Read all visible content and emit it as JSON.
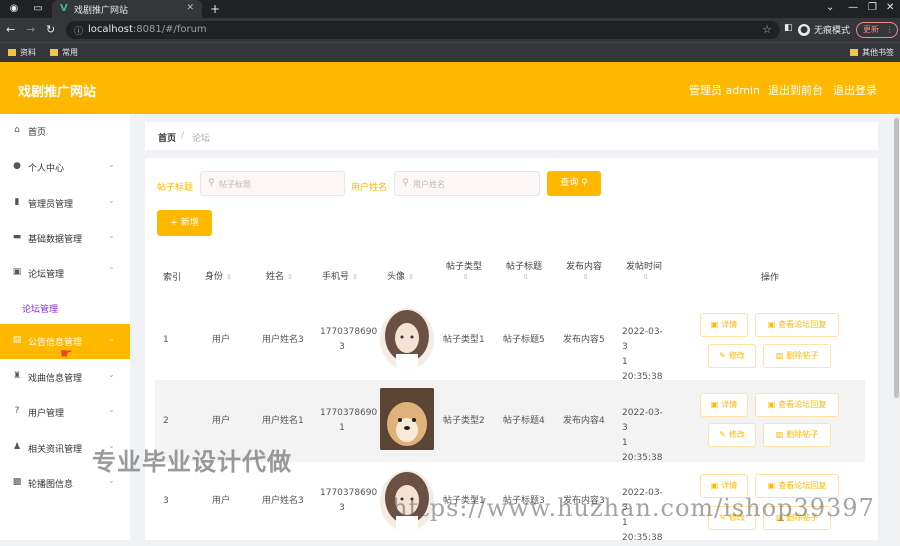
{
  "browser": {
    "tab_title": "戏剧推广网站",
    "url_host": "localhost",
    "url_rest": ":8081/#/forum",
    "profile_label": "无痕模式",
    "update_label": "更新",
    "bookmarks": [
      "资料",
      "常用"
    ],
    "other_bookmarks": "其他书签"
  },
  "header": {
    "title": "戏剧推广网站",
    "admin_label": "管理员 admin",
    "back_label": "退出到前台",
    "logout_label": "退出登录"
  },
  "sidebar": {
    "items": [
      {
        "label": "首页",
        "icon": "home-icon"
      },
      {
        "label": "个人中心",
        "icon": "user-icon"
      },
      {
        "label": "管理员管理",
        "icon": "chart-icon"
      },
      {
        "label": "基础数据管理",
        "icon": "monitor-icon"
      },
      {
        "label": "论坛管理",
        "icon": "forum-icon"
      },
      {
        "label": "公告信息管理",
        "icon": "doc-icon"
      },
      {
        "label": "戏曲信息管理",
        "icon": "trophy-icon"
      },
      {
        "label": "用户管理",
        "icon": "question-icon"
      },
      {
        "label": "相关资讯管理",
        "icon": "person-icon"
      },
      {
        "label": "轮播图信息",
        "icon": "bag-icon"
      }
    ],
    "submenu_label": "论坛管理"
  },
  "breadcrumb": {
    "home": "首页",
    "separator": "/",
    "current": "论坛"
  },
  "search": {
    "title_label": "帖子标题",
    "title_placeholder": "帖子标题",
    "user_label": "用户姓名",
    "user_placeholder": "用户姓名",
    "query_label": "查询",
    "add_label": "新增"
  },
  "table": {
    "headers": [
      "索引",
      "身份",
      "姓名",
      "手机号",
      "头像",
      "帖子类型",
      "帖子标题",
      "发布内容",
      "发帖时间",
      "操作"
    ],
    "rows": [
      {
        "index": "1",
        "role": "用户",
        "name": "用户姓名3",
        "phone_a": "1770378690",
        "phone_b": "3",
        "type": "帖子类型1",
        "title": "帖子标题5",
        "content": "发布内容5",
        "time_a": "2022-03-3",
        "time_b": "1 20:35:38"
      },
      {
        "index": "2",
        "role": "用户",
        "name": "用户姓名1",
        "phone_a": "1770378690",
        "phone_b": "1",
        "type": "帖子类型2",
        "title": "帖子标题4",
        "content": "发布内容4",
        "time_a": "2022-03-3",
        "time_b": "1 20:35:38"
      },
      {
        "index": "3",
        "role": "用户",
        "name": "用户姓名3",
        "phone_a": "1770378690",
        "phone_b": "3",
        "type": "帖子类型1",
        "title": "帖子标题3",
        "content": "发布内容3",
        "time_a": "2022-03-3",
        "time_b": "1 20:35:38"
      }
    ],
    "actions": {
      "detail": "详情",
      "view_replies": "查看论坛回复",
      "edit": "修改",
      "delete": "删除帖子"
    }
  },
  "watermark": {
    "cn": "专业毕业设计代做",
    "url": "https://www.huzhan.com/ishop39397"
  },
  "colors": {
    "accent": "#ffb800",
    "submenu": "#8a2be2"
  }
}
